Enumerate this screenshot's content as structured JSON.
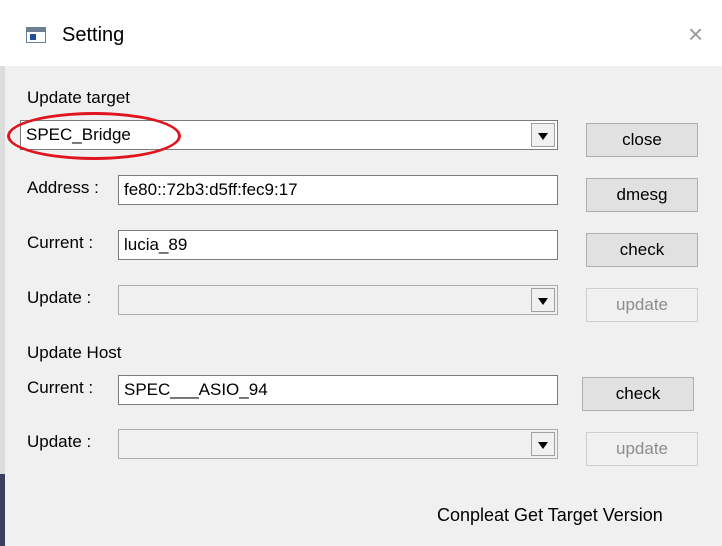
{
  "window": {
    "title": "Setting",
    "close_glyph": "×"
  },
  "update_target": {
    "section_label": "Update target",
    "target_value": "SPEC_Bridge",
    "address_label": "Address :",
    "address_value": "fe80::72b3:d5ff:fec9:17",
    "current_label": "Current :",
    "current_value": "lucia_89",
    "update_label": "Update :",
    "update_value": ""
  },
  "update_host": {
    "section_label": "Update Host",
    "current_label": "Current :",
    "current_value": "SPEC___ASIO_94",
    "update_label": "Update :",
    "update_value": ""
  },
  "buttons": {
    "close": "close",
    "dmesg": "dmesg",
    "check_target": "check",
    "update_target": "update",
    "check_host": "check",
    "update_host": "update"
  },
  "status_text": "Conpleat Get Target Version",
  "colors": {
    "highlight": "#e0141e",
    "dialog_bg": "#f0f0f0"
  }
}
